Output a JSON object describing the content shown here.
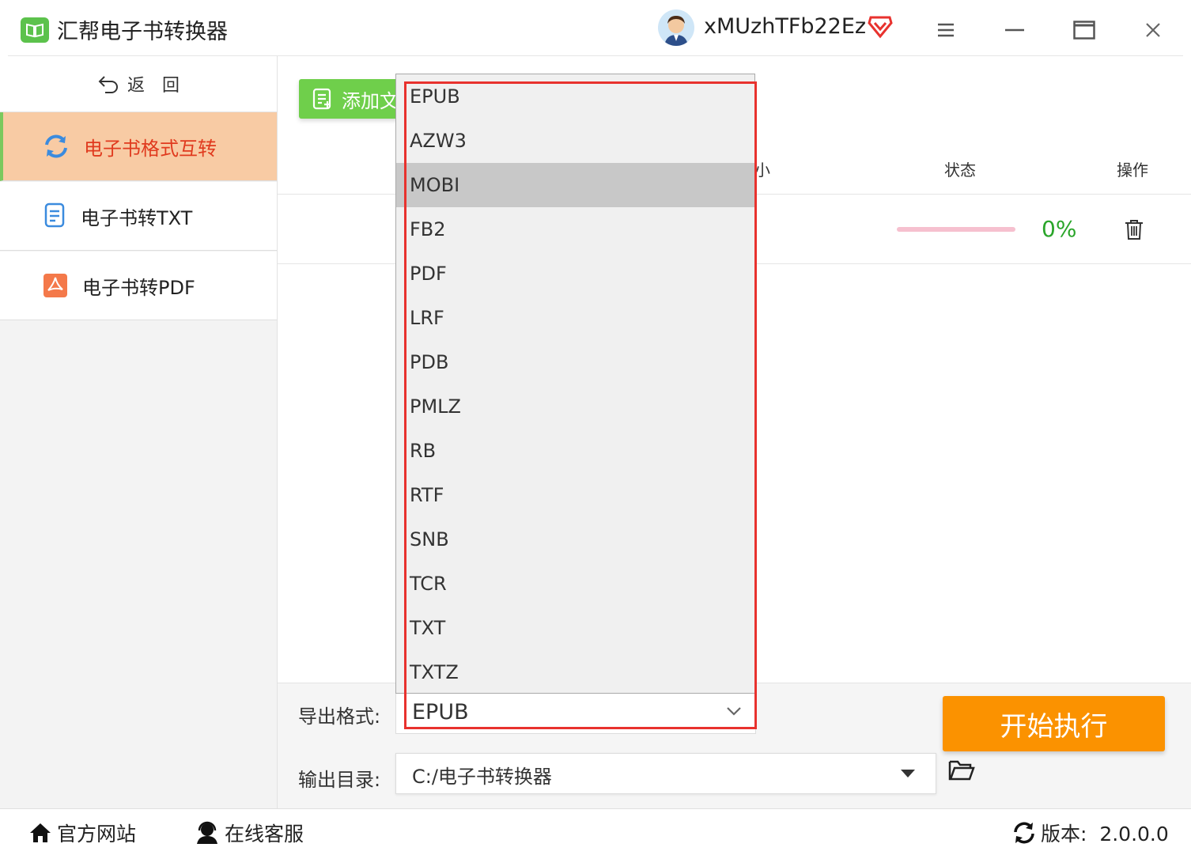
{
  "app": {
    "title": "汇帮电子书转换器",
    "username": "xMUzhTFb22Ez"
  },
  "sidebar": {
    "back_label": "返　回",
    "items": [
      {
        "label": "电子书格式互转",
        "icon": "refresh-icon",
        "active": true
      },
      {
        "label": "电子书转TXT",
        "icon": "document-icon",
        "active": false
      },
      {
        "label": "电子书转PDF",
        "icon": "pdf-icon",
        "active": false
      }
    ]
  },
  "toolbar": {
    "add_file_label": "添加文"
  },
  "table": {
    "headers": {
      "size_partial": "小",
      "status": "状态",
      "action": "操作"
    },
    "rows": [
      {
        "progress": 0,
        "progress_text": "0%"
      }
    ]
  },
  "dropdown": {
    "options": [
      "EPUB",
      "AZW3",
      "MOBI",
      "FB2",
      "PDF",
      "LRF",
      "PDB",
      "PMLZ",
      "RB",
      "RTF",
      "SNB",
      "TCR",
      "TXT",
      "TXTZ"
    ],
    "highlighted": "MOBI"
  },
  "bottom": {
    "export_label": "导出格式:",
    "export_value": "EPUB",
    "output_label": "输出目录:",
    "output_value": "C:/电子书转换器",
    "start_label": "开始执行"
  },
  "statusbar": {
    "website_label": "官方网站",
    "support_label": "在线客服",
    "version_label": "版本:  2.0.0.0"
  },
  "colors": {
    "accent_green": "#6fcf4b",
    "active_bg": "#f8cba4",
    "active_text": "#e03a1e",
    "start_orange": "#fb9200",
    "highlight_red": "#e8322e"
  }
}
